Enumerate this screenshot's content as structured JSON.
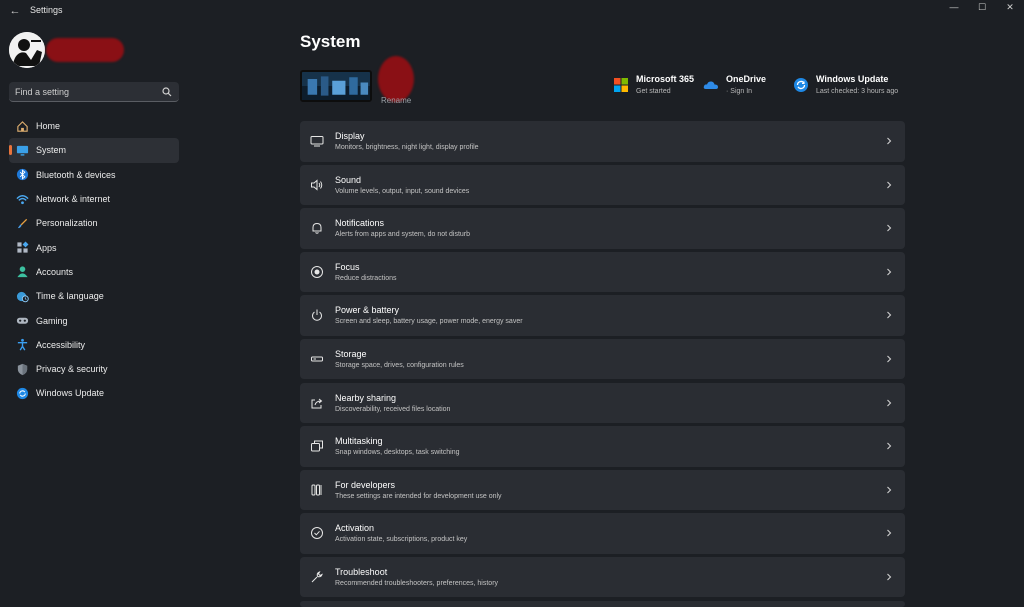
{
  "window": {
    "title": "Settings",
    "minimize": "—",
    "maximize": "☐",
    "close": "✕"
  },
  "sidebar": {
    "search": {
      "placeholder": "Find a setting"
    },
    "items": [
      {
        "label": "Home",
        "icon": "home-icon"
      },
      {
        "label": "System",
        "icon": "monitor-icon",
        "active": true
      },
      {
        "label": "Bluetooth & devices",
        "icon": "bluetooth-icon"
      },
      {
        "label": "Network & internet",
        "icon": "wifi-icon"
      },
      {
        "label": "Personalization",
        "icon": "brush-icon"
      },
      {
        "label": "Apps",
        "icon": "apps-icon"
      },
      {
        "label": "Accounts",
        "icon": "person-icon"
      },
      {
        "label": "Time & language",
        "icon": "globe-clock-icon"
      },
      {
        "label": "Gaming",
        "icon": "gamepad-icon"
      },
      {
        "label": "Accessibility",
        "icon": "accessibility-icon"
      },
      {
        "label": "Privacy & security",
        "icon": "shield-icon"
      },
      {
        "label": "Windows Update",
        "icon": "update-icon"
      }
    ],
    "accent": "#e8743c"
  },
  "main": {
    "title": "System",
    "device": {
      "rename_label": "Rename"
    },
    "quick_links": [
      {
        "title": "Microsoft 365",
        "subtitle": "Get started",
        "icon": "microsoft-365-icon"
      },
      {
        "title": "OneDrive",
        "subtitle": "· Sign In",
        "icon": "onedrive-icon"
      },
      {
        "title": "Windows Update",
        "subtitle": "Last checked: 3 hours ago",
        "icon": "windows-update-icon"
      }
    ],
    "cards": [
      {
        "title": "Display",
        "subtitle": "Monitors, brightness, night light, display profile",
        "icon": "display-icon"
      },
      {
        "title": "Sound",
        "subtitle": "Volume levels, output, input, sound devices",
        "icon": "speaker-icon"
      },
      {
        "title": "Notifications",
        "subtitle": "Alerts from apps and system, do not disturb",
        "icon": "bell-icon"
      },
      {
        "title": "Focus",
        "subtitle": "Reduce distractions",
        "icon": "focus-icon"
      },
      {
        "title": "Power & battery",
        "subtitle": "Screen and sleep, battery usage, power mode, energy saver",
        "icon": "power-icon"
      },
      {
        "title": "Storage",
        "subtitle": "Storage space, drives, configuration rules",
        "icon": "storage-icon"
      },
      {
        "title": "Nearby sharing",
        "subtitle": "Discoverability, received files location",
        "icon": "share-icon"
      },
      {
        "title": "Multitasking",
        "subtitle": "Snap windows, desktops, task switching",
        "icon": "multitasking-icon"
      },
      {
        "title": "For developers",
        "subtitle": "These settings are intended for development use only",
        "icon": "developer-tools-icon"
      },
      {
        "title": "Activation",
        "subtitle": "Activation state, subscriptions, product key",
        "icon": "check-circle-icon"
      },
      {
        "title": "Troubleshoot",
        "subtitle": "Recommended troubleshooters, preferences, history",
        "icon": "wrench-icon"
      }
    ]
  },
  "colors": {
    "background": "#1c1f24",
    "card": "#2a2d33",
    "redaction": "#8a1015"
  }
}
